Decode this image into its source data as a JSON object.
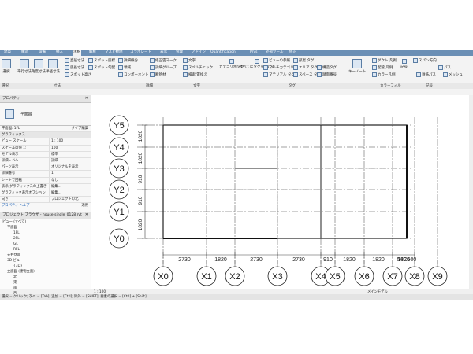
{
  "ribbon_tabs": [
    "建築",
    "構造",
    "設備",
    "挿入",
    "注釈",
    "解析",
    "マスと敷地",
    "コラボレート",
    "表示",
    "管理",
    "アドイン",
    "Quantification",
    "Prvs",
    "外部ツール",
    "修正"
  ],
  "active_tab": "注釈",
  "ribbon": {
    "dimension_tools": [
      "平行寸法",
      "角度寸法",
      "半径寸法",
      "直径寸法",
      "弧長寸法",
      "スポット高さ",
      "スポット座標",
      "スポット勾配"
    ],
    "detail_tools": [
      "詳細線分",
      "領域",
      "コンポーネント",
      "修正雲マーク",
      "詳細グループ",
      "断熱材"
    ],
    "text_tools": [
      "文字",
      "スペルチェック",
      "検索/置換え"
    ],
    "tag_tools": [
      "カテゴリ別タグ",
      "すべてにタグを付ける",
      "ビューの参照",
      "マルチカテゴリ",
      "マテリアル タグ",
      "部屋 タグ",
      "エリア タグ",
      "スペース タグ",
      "構造タグ",
      "踏面番号",
      "キーノート"
    ],
    "legend_tools": [
      "ダクト 凡例",
      "配管 凡例",
      "カラー凡例",
      "スパン方向",
      "パス",
      "記号",
      "鉄筋パス",
      "メッシュ"
    ],
    "panel_labels": [
      "選択",
      "寸法",
      "詳細",
      "文字",
      "タグ",
      "カラーフィル",
      "記号"
    ]
  },
  "properties": {
    "title": "プロパティ",
    "type_name": "平面図",
    "view_selector": "平面図: 1FL",
    "edit_type": "タイプ編集",
    "section": "グラフィックス",
    "rows": [
      {
        "k": "ビュー スケール",
        "v": "1 : 100"
      },
      {
        "k": "スケールの値 1:",
        "v": "100"
      },
      {
        "k": "モデル表示",
        "v": "標準"
      },
      {
        "k": "詳細レベル",
        "v": "詳細"
      },
      {
        "k": "パーツ表示",
        "v": "オリジナルを表示"
      },
      {
        "k": "詳細番号",
        "v": "1"
      },
      {
        "k": "シートで回転",
        "v": "なし"
      },
      {
        "k": "表示/グラフィックスの上書き",
        "v": "編集..."
      },
      {
        "k": "グラフィック表示オプション",
        "v": "編集..."
      },
      {
        "k": "向き",
        "v": "プロジェクトの北"
      }
    ],
    "help_link": "プロパティ ヘルプ",
    "apply": "適用"
  },
  "browser": {
    "title": "プロジェクト ブラウザ - house-single_0128.rvt",
    "items": [
      "ビュー (すべて)",
      "平面図",
      "1FL",
      "2FL",
      "GL",
      "RFL",
      "天井伏図",
      "3D ビュー",
      "{3D}",
      "立面図 (建物立面)",
      "北",
      "東",
      "南",
      "西"
    ]
  },
  "grid_labels_x": [
    "X0",
    "X1",
    "X2",
    "X3",
    "X4",
    "X5",
    "X6",
    "X7",
    "X8",
    "X9"
  ],
  "grid_labels_y": [
    "Y0",
    "Y1",
    "Y2",
    "Y3",
    "Y4",
    "Y5"
  ],
  "dims_x": [
    "2730",
    "1820",
    "2730",
    "2730",
    "910",
    "1820",
    "1820",
    "1820",
    "54C500"
  ],
  "dims_y": [
    "1820",
    "910",
    "910",
    "1820",
    "1820"
  ],
  "status": {
    "scale": "1 : 100",
    "main_model": "メインモデル",
    "hint": "選択 = クリック; 次へ = [Tab]; 追加 = [Ctrl]; 除外 = [SHIFT]; 要素の選択 = [Ctrl] + [Shift] ..."
  }
}
